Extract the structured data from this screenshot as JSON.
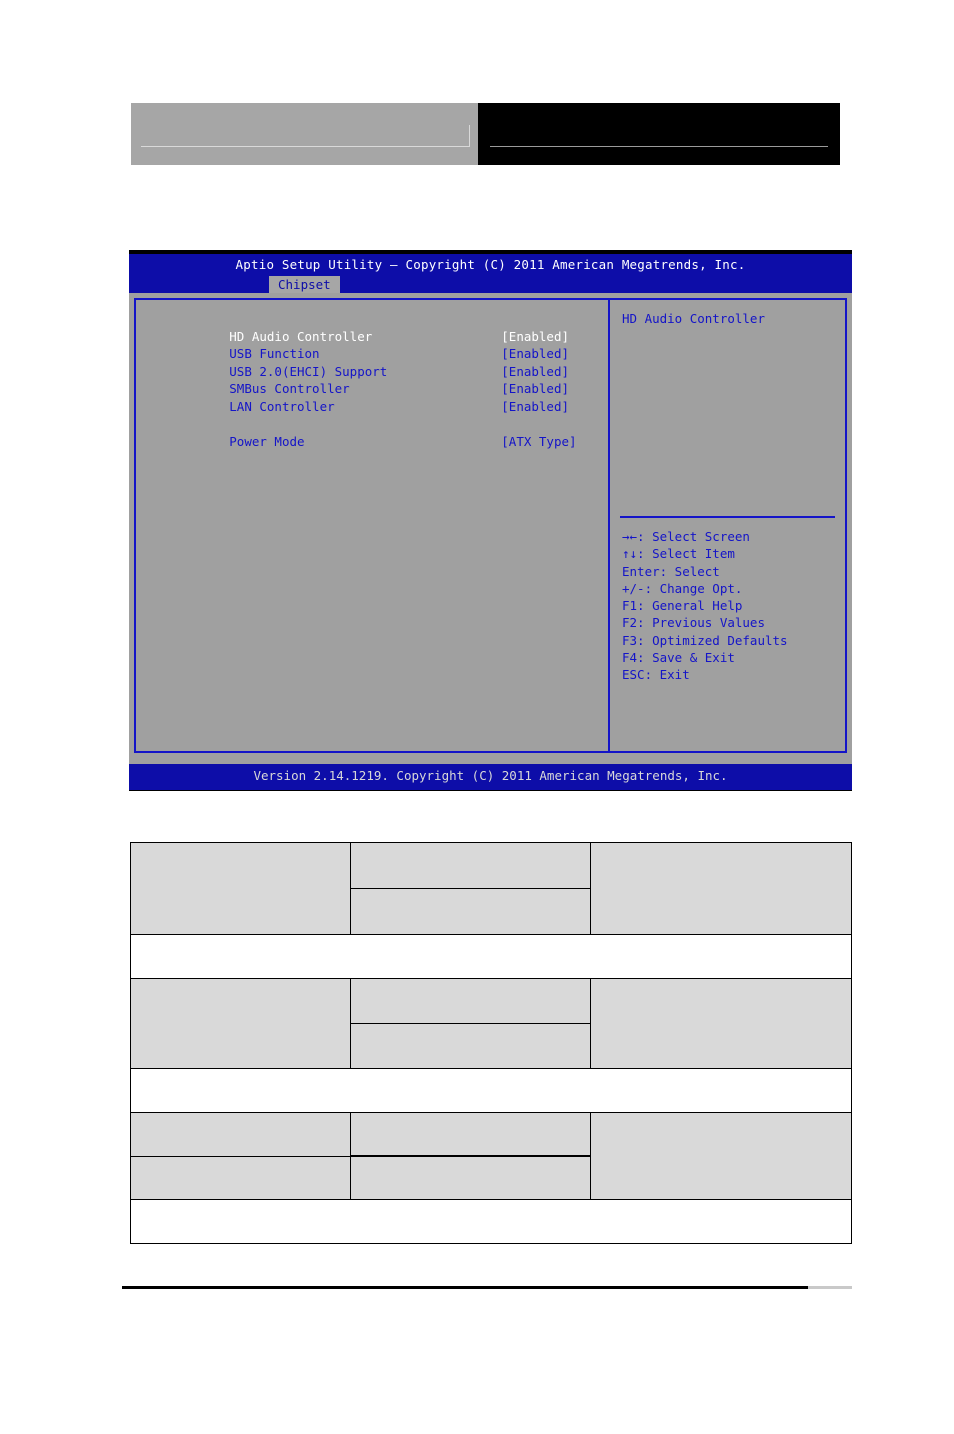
{
  "document": {
    "header": {
      "left_block": "",
      "right_block": ""
    }
  },
  "bios": {
    "titlebar": "Aptio Setup Utility – Copyright (C) 2011 American Megatrends, Inc.",
    "tabs": [
      {
        "label": "Chipset",
        "active": true
      }
    ],
    "settings": [
      {
        "label": "HD Audio Controller",
        "value": "[Enabled]",
        "selected": true
      },
      {
        "label": "USB Function",
        "value": "[Enabled]",
        "selected": false
      },
      {
        "label": "USB 2.0(EHCI) Support",
        "value": "[Enabled]",
        "selected": false
      },
      {
        "label": "SMBus Controller",
        "value": "[Enabled]",
        "selected": false
      },
      {
        "label": "LAN Controller",
        "value": "[Enabled]",
        "selected": false
      },
      {
        "label": "",
        "value": "",
        "selected": false
      },
      {
        "label": "Power Mode",
        "value": "[ATX Type]",
        "selected": false
      }
    ],
    "help": {
      "title": "HD Audio Controller",
      "keys": [
        "→←: Select Screen",
        "↑↓: Select Item",
        "Enter: Select",
        "+/-: Change Opt.",
        "F1: General Help",
        "F2: Previous Values",
        "F3: Optimized Defaults",
        "F4: Save & Exit",
        "ESC: Exit"
      ]
    },
    "footer": "Version 2.14.1219. Copyright (C) 2011 American Megatrends, Inc.",
    "colors": {
      "background": "#0d0da8",
      "panel": "#a0a0a0",
      "border": "#1414c8",
      "text_normal": "#1414c8",
      "text_selected": "#ffffff",
      "titlebar_text": "#ffffff"
    }
  },
  "spec_table": {
    "rows": [
      {
        "type": "group",
        "cells": {
          "a": "",
          "b_top": "",
          "b_bottom": "",
          "c": ""
        }
      },
      {
        "type": "full",
        "cells": {
          "a": ""
        }
      },
      {
        "type": "group",
        "cells": {
          "a": "",
          "b_top": "",
          "b_bottom": "",
          "c": ""
        }
      },
      {
        "type": "full",
        "cells": {
          "a": ""
        }
      },
      {
        "type": "group-split",
        "cells": {
          "a_top": "",
          "a_bottom": "",
          "b_top": "",
          "b_bottom": "",
          "c": ""
        }
      },
      {
        "type": "full",
        "cells": {
          "a": ""
        }
      }
    ]
  }
}
